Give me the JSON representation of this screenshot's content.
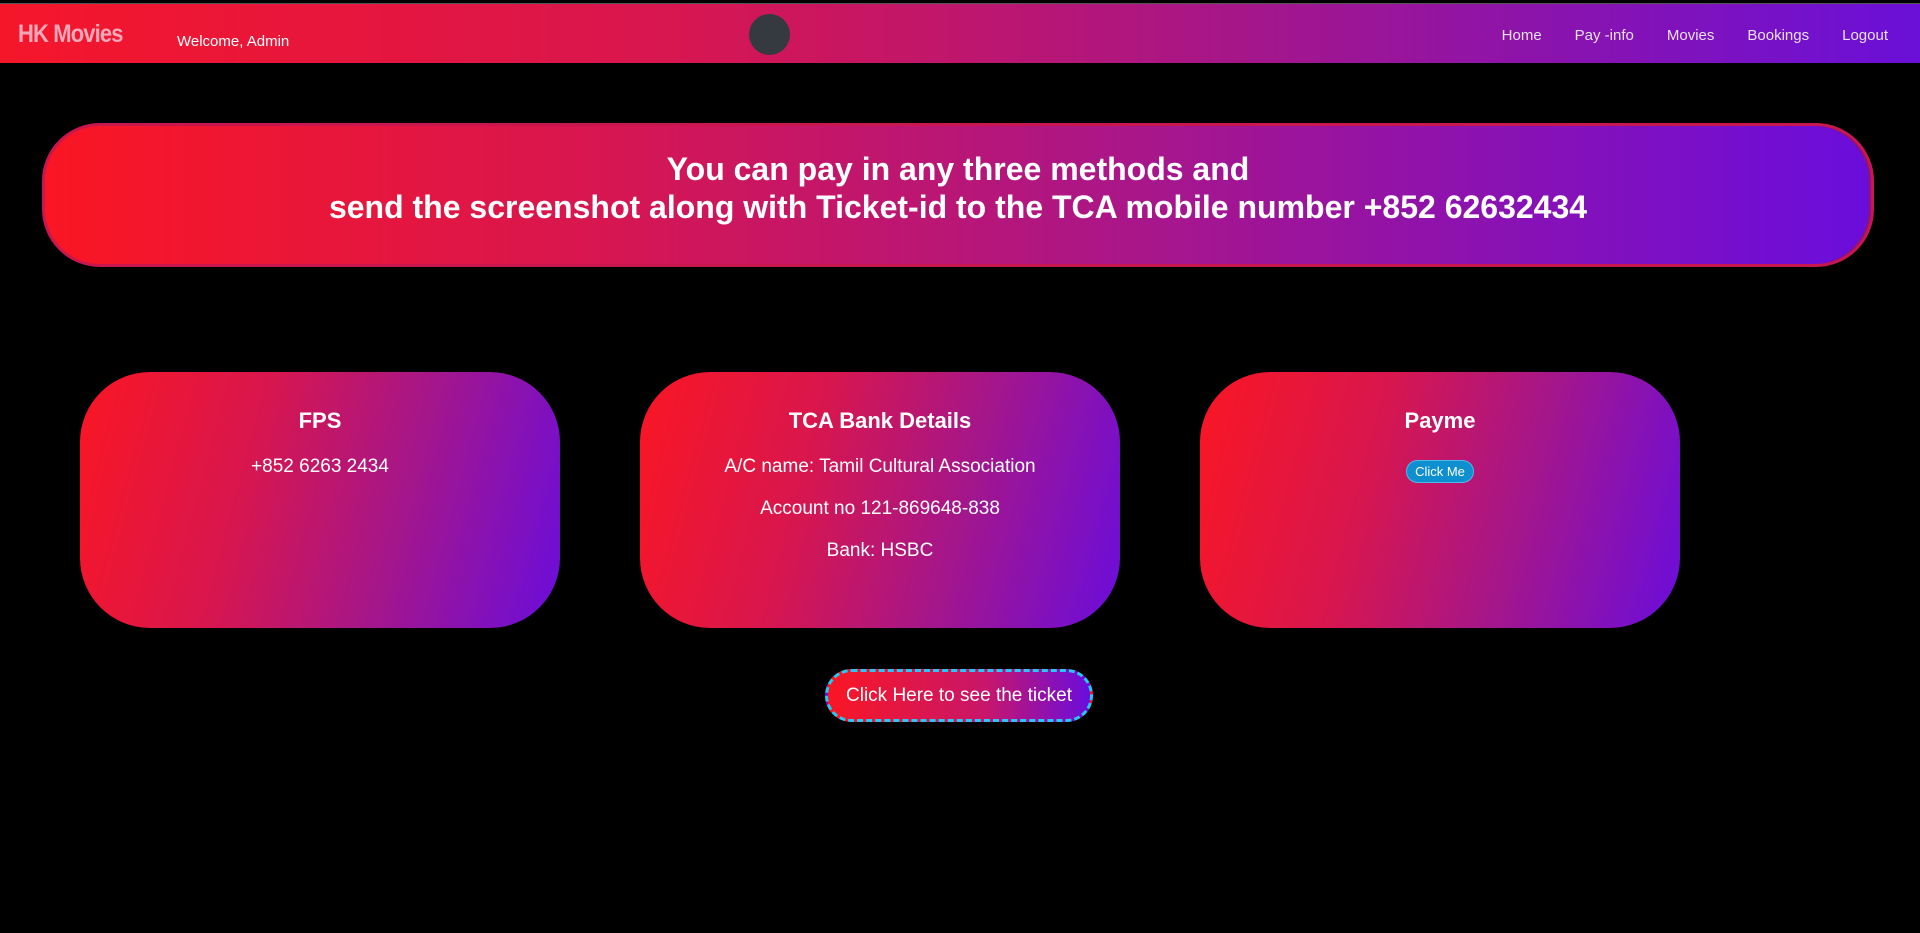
{
  "nav": {
    "brand": "HK Movies",
    "welcome": "Welcome, Admin",
    "avatar_color": "#343a40",
    "links": [
      "Home",
      "Pay -info",
      "Movies",
      "Bookings",
      "Logout"
    ]
  },
  "banner": {
    "line1": "You can pay in any three methods and",
    "line2": "send the screenshot along with Ticket-id to the TCA mobile number +852 62632434"
  },
  "cards": {
    "fps": {
      "title": "FPS",
      "phone": "+852 6263 2434"
    },
    "bank": {
      "title": "TCA Bank Details",
      "ac_name": "A/C name: Tamil Cultural Association",
      "account_no": "Account no 121-869648-838",
      "bank": "Bank: HSBC"
    },
    "payme": {
      "title": "Payme",
      "button": "Click Me"
    }
  },
  "ticket_button": "Click Here to see the ticket",
  "colors": {
    "gradient_start": "#fa1623",
    "gradient_end": "#6a0ddc",
    "accent_dashed": "#29c7f5",
    "payme_button": "#0e8fd0"
  }
}
